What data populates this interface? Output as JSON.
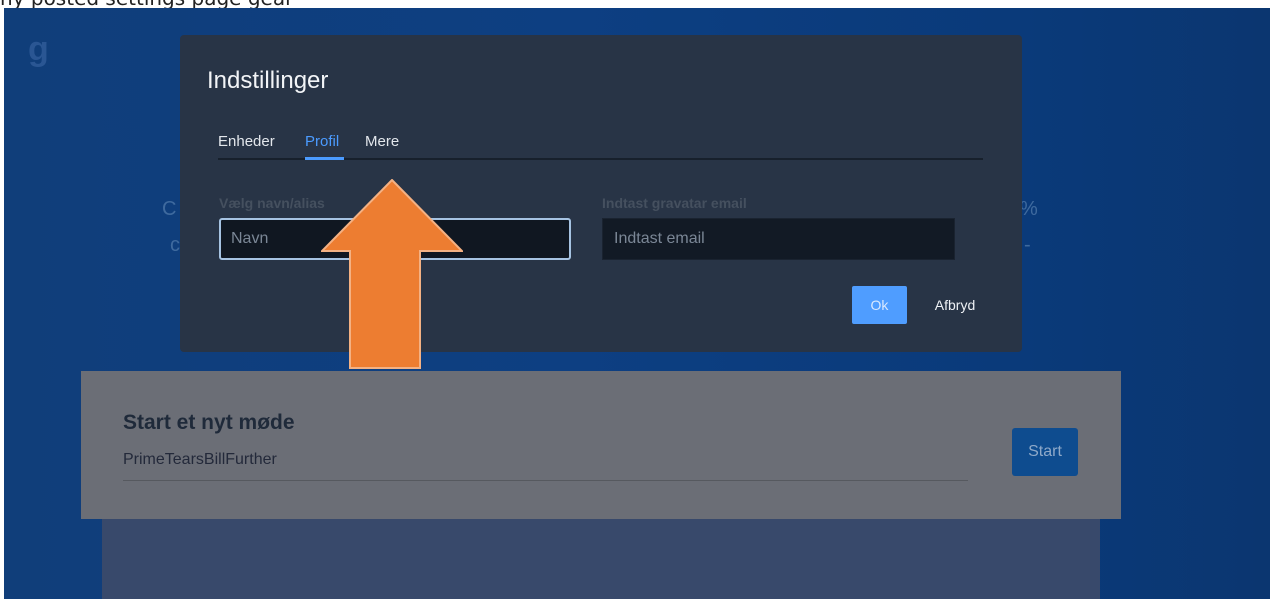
{
  "top_strip_text": "ny posted settings page gear",
  "background": {
    "logo_char": "g",
    "left_text_1": "C",
    "left_text_2": "c",
    "right_text_1": "%",
    "right_text_2": "-"
  },
  "dialog": {
    "title": "Indstillinger",
    "tabs": [
      {
        "label": "Enheder",
        "active": false
      },
      {
        "label": "Profil",
        "active": true
      },
      {
        "label": "Mere",
        "active": false
      }
    ],
    "name_field": {
      "label": "Vælg navn/alias",
      "placeholder": "Navn",
      "value": ""
    },
    "email_field": {
      "label": "Indtast gravatar email",
      "placeholder": "Indtast email",
      "value": ""
    },
    "ok_label": "Ok",
    "cancel_label": "Afbryd"
  },
  "start_card": {
    "title": "Start et nyt møde",
    "room_name": "PrimeTearsBillFurther",
    "start_label": "Start"
  },
  "colors": {
    "accent": "#4b9bff",
    "arrow": "#ed7d31",
    "dialog_bg": "#283446",
    "start_button": "#0e4c8f"
  },
  "icons": {
    "annotation": "orange-up-arrow"
  }
}
